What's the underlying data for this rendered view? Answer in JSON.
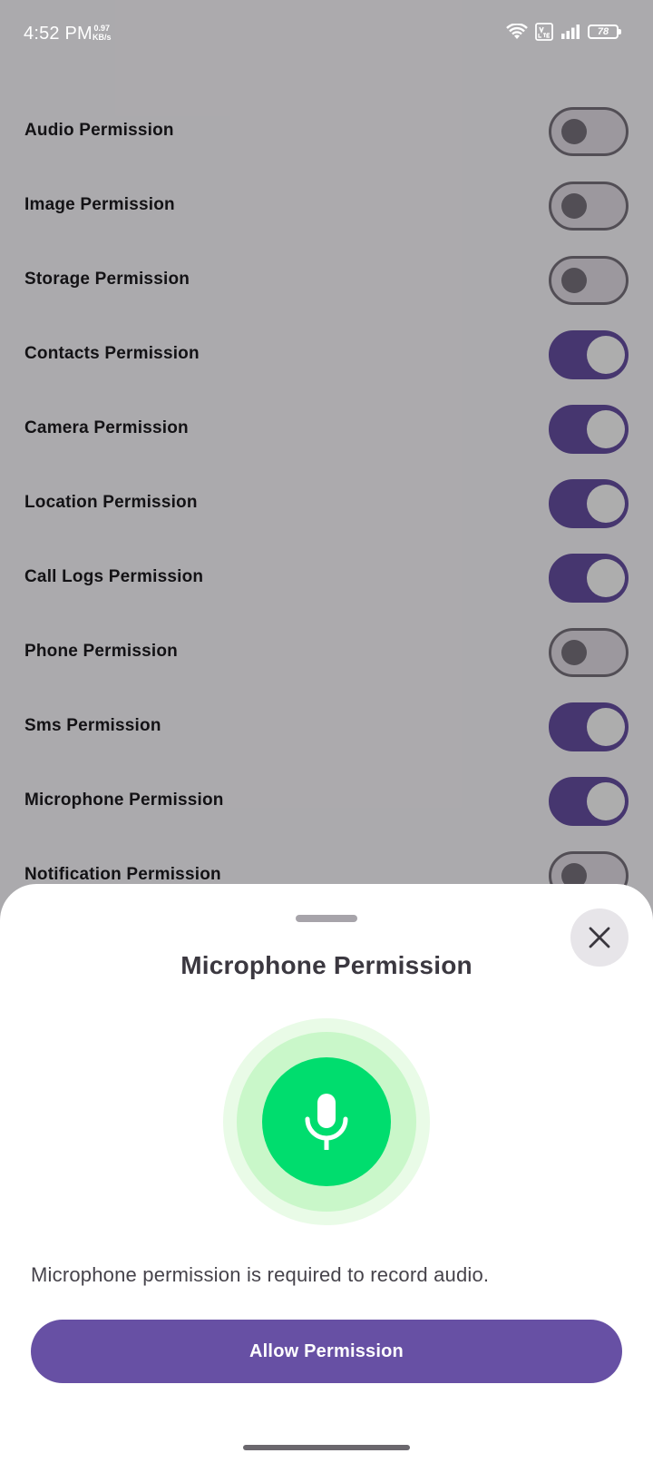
{
  "status_bar": {
    "time": "4:52 PM",
    "speed_value": "0.97",
    "speed_unit": "KB/s",
    "battery": "78",
    "icons": [
      "wifi-icon",
      "volte-icon",
      "signal-icon",
      "battery-icon"
    ]
  },
  "permissions": [
    {
      "label": "Audio Permission",
      "enabled": false
    },
    {
      "label": "Image Permission",
      "enabled": false
    },
    {
      "label": "Storage Permission",
      "enabled": false
    },
    {
      "label": "Contacts Permission",
      "enabled": true
    },
    {
      "label": "Camera Permission",
      "enabled": true
    },
    {
      "label": "Location Permission",
      "enabled": true
    },
    {
      "label": "Call Logs Permission",
      "enabled": true
    },
    {
      "label": "Phone Permission",
      "enabled": false
    },
    {
      "label": "Sms Permission",
      "enabled": true
    },
    {
      "label": "Microphone Permission",
      "enabled": true
    },
    {
      "label": "Notification Permission",
      "enabled": false
    }
  ],
  "sheet": {
    "title": "Microphone Permission",
    "icon": "microphone-icon",
    "description": "Microphone permission is required to record audio.",
    "button_label": "Allow Permission",
    "close_icon": "close-icon"
  },
  "colors": {
    "primary": "#6750a4",
    "mic_green": "#00dd6e",
    "mic_ring_light": "#c9f7c9",
    "mic_ring_outer": "#e9fbe7"
  }
}
